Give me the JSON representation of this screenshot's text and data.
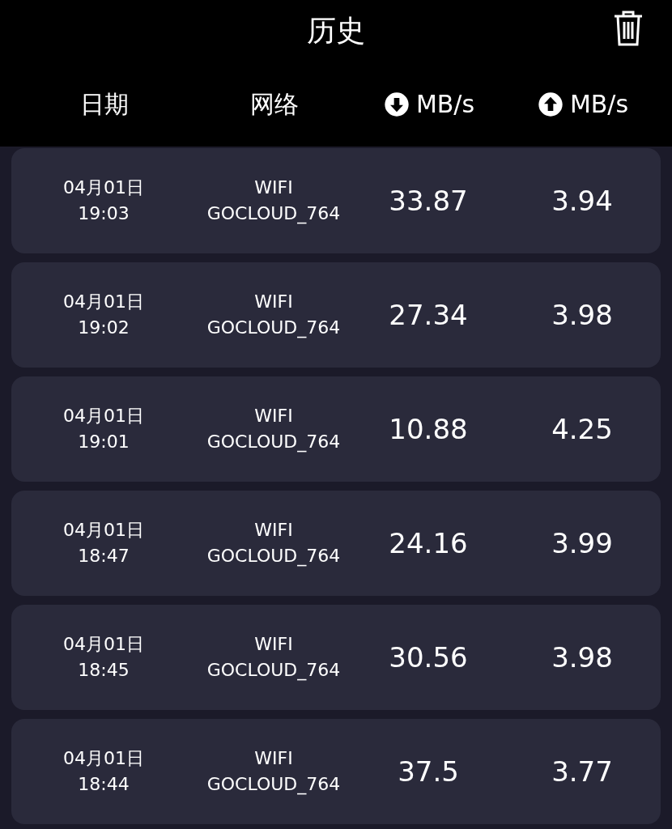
{
  "header": {
    "title": "历史"
  },
  "columns": [
    {
      "kind": "text",
      "label": "日期"
    },
    {
      "kind": "text",
      "label": "网络"
    },
    {
      "kind": "download",
      "label": "MB/s"
    },
    {
      "kind": "upload",
      "label": "MB/s"
    }
  ],
  "rows": [
    {
      "date": "04月01日",
      "time": "19:03",
      "network_type": "WIFI",
      "network_name": "GOCLOUD_764",
      "download": "33.87",
      "upload": "3.94"
    },
    {
      "date": "04月01日",
      "time": "19:02",
      "network_type": "WIFI",
      "network_name": "GOCLOUD_764",
      "download": "27.34",
      "upload": "3.98"
    },
    {
      "date": "04月01日",
      "time": "19:01",
      "network_type": "WIFI",
      "network_name": "GOCLOUD_764",
      "download": "10.88",
      "upload": "4.25"
    },
    {
      "date": "04月01日",
      "time": "18:47",
      "network_type": "WIFI",
      "network_name": "GOCLOUD_764",
      "download": "24.16",
      "upload": "3.99"
    },
    {
      "date": "04月01日",
      "time": "18:45",
      "network_type": "WIFI",
      "network_name": "GOCLOUD_764",
      "download": "30.56",
      "upload": "3.98"
    },
    {
      "date": "04月01日",
      "time": "18:44",
      "network_type": "WIFI",
      "network_name": "GOCLOUD_764",
      "download": "37.5",
      "upload": "3.77"
    }
  ]
}
